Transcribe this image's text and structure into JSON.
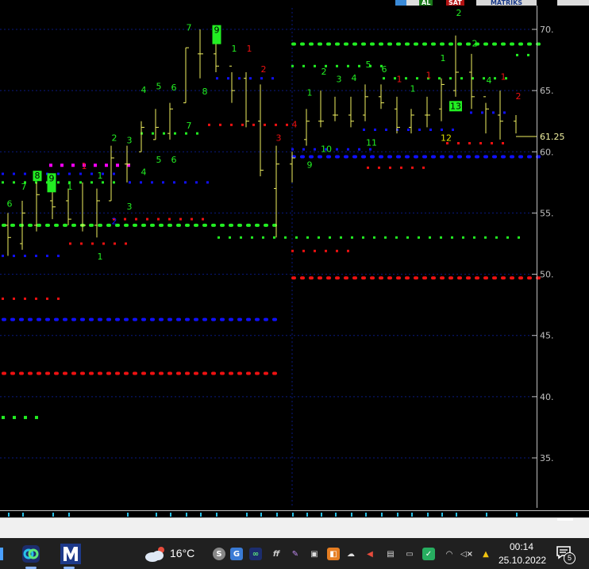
{
  "top_strip": {
    "items": [
      {
        "label": "AL",
        "bg": "#1a7a1a",
        "fg": "#ffffff"
      },
      {
        "label": "SAT",
        "bg": "#b31212",
        "fg": "#ffffff"
      },
      {
        "label": "MATRIKS",
        "bg": "#d8d8d8",
        "fg": "#1a3a8a"
      }
    ]
  },
  "chart_data": {
    "type": "bar",
    "price_axis": {
      "ticks": [
        "70.",
        "65.",
        "60.",
        "55.",
        "50.",
        "45.",
        "40.",
        "35."
      ],
      "current_price": "61.25"
    },
    "ylim": [
      32,
      73.5
    ],
    "bars": [
      {
        "x": 10,
        "o": 54,
        "h": 55,
        "l": 51.5,
        "c": 53
      },
      {
        "x": 28,
        "o": 52.5,
        "h": 56,
        "l": 52,
        "c": 55
      },
      {
        "x": 46,
        "o": 54,
        "h": 57.5,
        "l": 53.5,
        "c": 56.5
      },
      {
        "x": 66,
        "o": 56,
        "h": 58,
        "l": 54.5,
        "c": 55.5
      },
      {
        "x": 86,
        "o": 56,
        "h": 57,
        "l": 54,
        "c": 54.5
      },
      {
        "x": 104,
        "o": 54,
        "h": 57.5,
        "l": 53.5,
        "c": 54
      },
      {
        "x": 122,
        "o": 54,
        "h": 57,
        "l": 53,
        "c": 56
      },
      {
        "x": 140,
        "o": 56,
        "h": 60.5,
        "l": 56,
        "c": 59.5
      },
      {
        "x": 160,
        "o": 59,
        "h": 60.5,
        "l": 57.5,
        "c": 59
      },
      {
        "x": 178,
        "o": 60,
        "h": 62.5,
        "l": 60,
        "c": 62
      },
      {
        "x": 196,
        "o": 61,
        "h": 63.5,
        "l": 61,
        "c": 62
      },
      {
        "x": 214,
        "o": 61.5,
        "h": 64,
        "l": 61,
        "c": 63.5
      },
      {
        "x": 234,
        "o": 64,
        "h": 68.5,
        "l": 64,
        "c": 68.5
      },
      {
        "x": 252,
        "o": 68,
        "h": 70,
        "l": 66,
        "c": 68
      },
      {
        "x": 272,
        "o": 68,
        "h": 69.5,
        "l": 66.5,
        "c": 67
      },
      {
        "x": 292,
        "o": 67,
        "h": 66.5,
        "l": 64,
        "c": 65
      },
      {
        "x": 310,
        "o": 66,
        "h": 66.5,
        "l": 62,
        "c": 62.5
      },
      {
        "x": 328,
        "o": 62.5,
        "h": 65.5,
        "l": 58,
        "c": 58.5
      },
      {
        "x": 348,
        "o": 57,
        "h": 60.5,
        "l": 53,
        "c": 59
      },
      {
        "x": 368,
        "o": 59,
        "h": 60,
        "l": 57.5,
        "c": 59.5
      },
      {
        "x": 386,
        "o": 61,
        "h": 63.5,
        "l": 60.5,
        "c": 62.5
      },
      {
        "x": 404,
        "o": 62.5,
        "h": 65,
        "l": 62,
        "c": 62.5
      },
      {
        "x": 422,
        "o": 63,
        "h": 64.5,
        "l": 62.5,
        "c": 63
      },
      {
        "x": 442,
        "o": 63,
        "h": 64.5,
        "l": 62,
        "c": 62.5
      },
      {
        "x": 460,
        "o": 63,
        "h": 65.5,
        "l": 62.5,
        "c": 64.5
      },
      {
        "x": 480,
        "o": 64.5,
        "h": 65.5,
        "l": 63.5,
        "c": 64
      },
      {
        "x": 500,
        "o": 63.5,
        "h": 64.5,
        "l": 61.5,
        "c": 62
      },
      {
        "x": 518,
        "o": 62,
        "h": 63.5,
        "l": 61.5,
        "c": 63
      },
      {
        "x": 538,
        "o": 63,
        "h": 64.5,
        "l": 62,
        "c": 63
      },
      {
        "x": 556,
        "o": 63.5,
        "h": 66,
        "l": 62.5,
        "c": 65.5
      },
      {
        "x": 574,
        "o": 65,
        "h": 69.5,
        "l": 64.5,
        "c": 66.5
      },
      {
        "x": 594,
        "o": 66.5,
        "h": 68,
        "l": 63.5,
        "c": 64.5
      },
      {
        "x": 612,
        "o": 64.5,
        "h": 64,
        "l": 61.5,
        "c": 63.5
      },
      {
        "x": 630,
        "o": 63,
        "h": 65,
        "l": 61,
        "c": 62.5
      },
      {
        "x": 650,
        "o": 62.5,
        "h": 63,
        "l": 61.5,
        "c": 61.25
      }
    ],
    "levels": [
      {
        "y": 54,
        "x1": 0,
        "x2": 350,
        "color": "#22ee22",
        "size": 5
      },
      {
        "y": 68.8,
        "x1": 365,
        "x2": 676,
        "color": "#22ee22",
        "size": 5
      },
      {
        "y": 53,
        "x1": 272,
        "x2": 660,
        "color": "#22ee22",
        "size": 3
      },
      {
        "y": 59.6,
        "x1": 365,
        "x2": 676,
        "color": "#1010ff",
        "size": 5
      },
      {
        "y": 46.3,
        "x1": 0,
        "x2": 352,
        "color": "#1010ff",
        "size": 5
      },
      {
        "y": 49.7,
        "x1": 365,
        "x2": 676,
        "color": "#ee1111",
        "size": 5
      },
      {
        "y": 41.9,
        "x1": 0,
        "x2": 352,
        "color": "#ee1111",
        "size": 5
      },
      {
        "y": 58.2,
        "x1": 0,
        "x2": 155,
        "color": "#1010ff",
        "size": 3
      },
      {
        "y": 58.9,
        "x1": 60,
        "x2": 165,
        "color": "#ff00ff",
        "size": 4
      },
      {
        "y": 57.5,
        "x1": 0,
        "x2": 150,
        "color": "#22ee22",
        "size": 3
      },
      {
        "y": 57.5,
        "x1": 160,
        "x2": 260,
        "color": "#1010ff",
        "size": 3
      },
      {
        "y": 54.5,
        "x1": 140,
        "x2": 260,
        "color": "#ee1111",
        "size": 3
      },
      {
        "y": 52.5,
        "x1": 85,
        "x2": 165,
        "color": "#ee1111",
        "size": 3
      },
      {
        "y": 51.5,
        "x1": 0,
        "x2": 75,
        "color": "#1010ff",
        "size": 3
      },
      {
        "y": 48,
        "x1": 0,
        "x2": 75,
        "color": "#ee1111",
        "size": 3
      },
      {
        "y": 38.3,
        "x1": 0,
        "x2": 55,
        "color": "#22ee22",
        "size": 4
      },
      {
        "y": 61.5,
        "x1": 175,
        "x2": 260,
        "color": "#22ee22",
        "size": 3
      },
      {
        "y": 62.2,
        "x1": 260,
        "x2": 365,
        "color": "#ee1111",
        "size": 3
      },
      {
        "y": 66,
        "x1": 270,
        "x2": 355,
        "color": "#1010ff",
        "size": 3
      },
      {
        "y": 67,
        "x1": 365,
        "x2": 480,
        "color": "#22ee22",
        "size": 3
      },
      {
        "y": 66,
        "x1": 480,
        "x2": 640,
        "color": "#22ee22",
        "size": 3
      },
      {
        "y": 61.8,
        "x1": 455,
        "x2": 580,
        "color": "#1010ff",
        "size": 3
      },
      {
        "y": 60.2,
        "x1": 365,
        "x2": 470,
        "color": "#1010ff",
        "size": 3
      },
      {
        "y": 58.7,
        "x1": 460,
        "x2": 545,
        "color": "#ee1111",
        "size": 3
      },
      {
        "y": 60.7,
        "x1": 560,
        "x2": 640,
        "color": "#ee1111",
        "size": 3
      },
      {
        "y": 51.9,
        "x1": 365,
        "x2": 450,
        "color": "#ee1111",
        "size": 3
      },
      {
        "y": 73.1,
        "x1": 270,
        "x2": 355,
        "color": "#22ee22",
        "size": 3
      },
      {
        "y": 63.2,
        "x1": 590,
        "x2": 640,
        "color": "#1010ff",
        "size": 3
      },
      {
        "y": 67.9,
        "x1": 648,
        "x2": 676,
        "color": "#22ee22",
        "size": 3
      }
    ],
    "counts": [
      {
        "x": 12,
        "y": 55.5,
        "t": "6",
        "c": "#22ee22"
      },
      {
        "x": 30,
        "y": 56.9,
        "t": "7",
        "c": "#22ee22"
      },
      {
        "x": 47,
        "y": 57.8,
        "t": "8",
        "c": "#000000",
        "box": "#22ee22"
      },
      {
        "x": 65,
        "y": 57.6,
        "t": "9",
        "c": "#000000",
        "box": "#22ee22",
        "tall": true
      },
      {
        "x": 88,
        "y": 56.9,
        "t": "1",
        "c": "#22ee22"
      },
      {
        "x": 106,
        "y": 58.6,
        "t": "1",
        "c": "#ee1111"
      },
      {
        "x": 126,
        "y": 57.8,
        "t": "1",
        "c": "#22ee22"
      },
      {
        "x": 126,
        "y": 51.2,
        "t": "1",
        "c": "#22ee22"
      },
      {
        "x": 144,
        "y": 60.9,
        "t": "2",
        "c": "#22ee22"
      },
      {
        "x": 144,
        "y": 54.1,
        "t": "2",
        "c": "#1010ff"
      },
      {
        "x": 163,
        "y": 60.7,
        "t": "3",
        "c": "#22ee22"
      },
      {
        "x": 163,
        "y": 55.3,
        "t": "3",
        "c": "#22ee22"
      },
      {
        "x": 181,
        "y": 64.8,
        "t": "4",
        "c": "#22ee22"
      },
      {
        "x": 181,
        "y": 58.1,
        "t": "4",
        "c": "#22ee22"
      },
      {
        "x": 200,
        "y": 65.1,
        "t": "5",
        "c": "#22ee22"
      },
      {
        "x": 200,
        "y": 59.1,
        "t": "5",
        "c": "#22ee22"
      },
      {
        "x": 219,
        "y": 65.0,
        "t": "6",
        "c": "#22ee22"
      },
      {
        "x": 219,
        "y": 59.1,
        "t": "6",
        "c": "#22ee22"
      },
      {
        "x": 238,
        "y": 69.9,
        "t": "7",
        "c": "#22ee22"
      },
      {
        "x": 238,
        "y": 61.9,
        "t": "7",
        "c": "#22ee22"
      },
      {
        "x": 254,
        "y": 72.4,
        "t": "8",
        "c": "#000000",
        "box": "#22ee22"
      },
      {
        "x": 258,
        "y": 64.7,
        "t": "8",
        "c": "#22ee22"
      },
      {
        "x": 273,
        "y": 69.7,
        "t": "9",
        "c": "#000000",
        "box": "#22ee22",
        "tall": true
      },
      {
        "x": 295,
        "y": 68.2,
        "t": "1",
        "c": "#22ee22"
      },
      {
        "x": 314,
        "y": 68.2,
        "t": "1",
        "c": "#ee1111"
      },
      {
        "x": 332,
        "y": 66.5,
        "t": "2",
        "c": "#ee1111"
      },
      {
        "x": 351,
        "y": 60.9,
        "t": "3",
        "c": "#ee1111"
      },
      {
        "x": 371,
        "y": 62.0,
        "t": "4",
        "c": "#ee1111"
      },
      {
        "x": 390,
        "y": 58.7,
        "t": "9",
        "c": "#22ee22"
      },
      {
        "x": 390,
        "y": 64.6,
        "t": "1",
        "c": "#22ee22"
      },
      {
        "x": 411,
        "y": 60.0,
        "t": "10",
        "c": "#22ee22"
      },
      {
        "x": 408,
        "y": 66.3,
        "t": "2",
        "c": "#22ee22"
      },
      {
        "x": 427,
        "y": 65.7,
        "t": "3",
        "c": "#22ee22"
      },
      {
        "x": 446,
        "y": 65.8,
        "t": "4",
        "c": "#22ee22"
      },
      {
        "x": 468,
        "y": 60.5,
        "t": "11",
        "c": "#22ee22"
      },
      {
        "x": 464,
        "y": 66.9,
        "t": "5",
        "c": "#22ee22"
      },
      {
        "x": 484,
        "y": 66.5,
        "t": "6",
        "c": "#22ee22"
      },
      {
        "x": 503,
        "y": 65.7,
        "t": "1",
        "c": "#ee1111"
      },
      {
        "x": 520,
        "y": 64.9,
        "t": "1",
        "c": "#22ee22"
      },
      {
        "x": 540,
        "y": 66.0,
        "t": "1",
        "c": "#ee1111"
      },
      {
        "x": 558,
        "y": 67.4,
        "t": "1",
        "c": "#22ee22"
      },
      {
        "x": 562,
        "y": 60.9,
        "t": "12",
        "c": "#dede00"
      },
      {
        "x": 574,
        "y": 63.5,
        "t": "13",
        "c": "#000000",
        "box": "#22ee22"
      },
      {
        "x": 578,
        "y": 71.1,
        "t": "2",
        "c": "#22ee22"
      },
      {
        "x": 598,
        "y": 68.6,
        "t": "2",
        "c": "#22ee22"
      },
      {
        "x": 616,
        "y": 65.6,
        "t": "4",
        "c": "#22ee22"
      },
      {
        "x": 634,
        "y": 65.9,
        "t": "1",
        "c": "#ee1111"
      },
      {
        "x": 653,
        "y": 64.3,
        "t": "2",
        "c": "#ee1111"
      }
    ],
    "v_markers": [
      10,
      28,
      66,
      86,
      160,
      196,
      214,
      234,
      252,
      272,
      310,
      328,
      348,
      368,
      386,
      404,
      422,
      442,
      460,
      480,
      500,
      518,
      538,
      556,
      574,
      612,
      650
    ],
    "divider_x": 368
  },
  "taskbar": {
    "weather": {
      "temp": "16°C"
    },
    "clock": {
      "time": "00:14",
      "date": "25.10.2022"
    },
    "notification_count": "5"
  },
  "colors": {
    "up": "#22ee22",
    "down": "#ee1111",
    "blue": "#1010ff",
    "price_bar": "#f0f060",
    "grid": "#0a1a80"
  }
}
